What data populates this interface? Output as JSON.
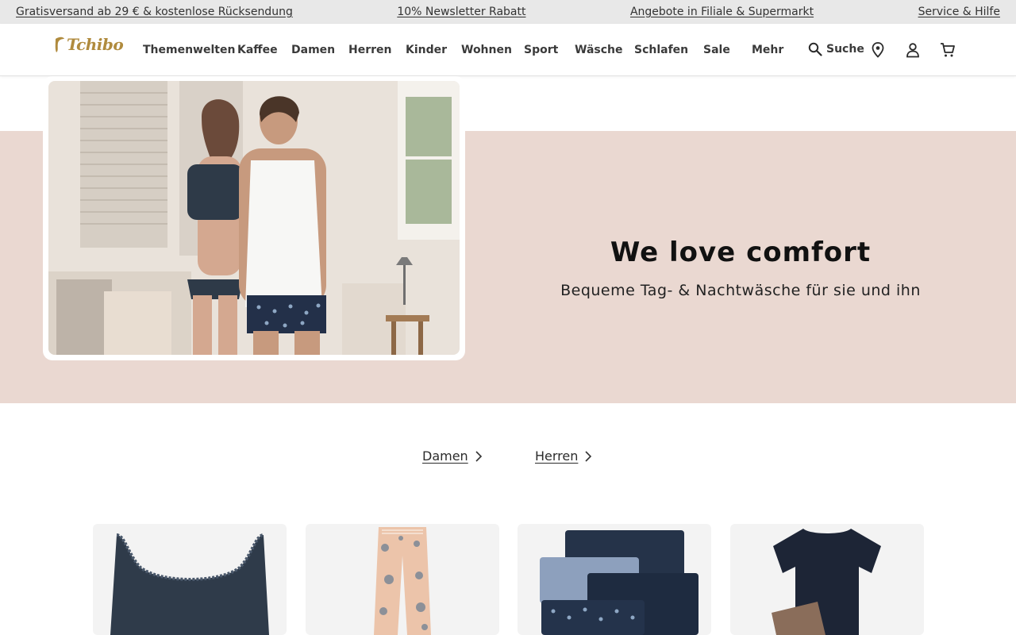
{
  "promo": {
    "free_shipping": "Gratisversand ab 29 € & kostenlose Rücksendung",
    "newsletter": "10% Newsletter Rabatt",
    "offers": "Angebote in Filiale & Supermarkt",
    "service": "Service & Hilfe"
  },
  "header": {
    "logo_text": "Tchibo",
    "nav": [
      "Themenwelten",
      "Kaffee",
      "Damen",
      "Herren",
      "Kinder",
      "Wohnen",
      "Sport",
      "Wäsche",
      "Schlafen",
      "Sale",
      "Mehr"
    ],
    "search_label": "Suche",
    "icons": [
      "search-icon",
      "location-pin-icon",
      "user-icon",
      "cart-icon"
    ]
  },
  "hero": {
    "title": "We love comfort",
    "subtitle": "Bequeme Tag- & Nachtwäsche für sie und ihn",
    "band_color": "#ead8d1"
  },
  "categories": {
    "damen": "Damen",
    "herren": "Herren"
  },
  "colors": {
    "brand_gold": "#b08b3e",
    "promo_bg": "#e8e8e8",
    "hero_bg": "#ead8d1"
  }
}
